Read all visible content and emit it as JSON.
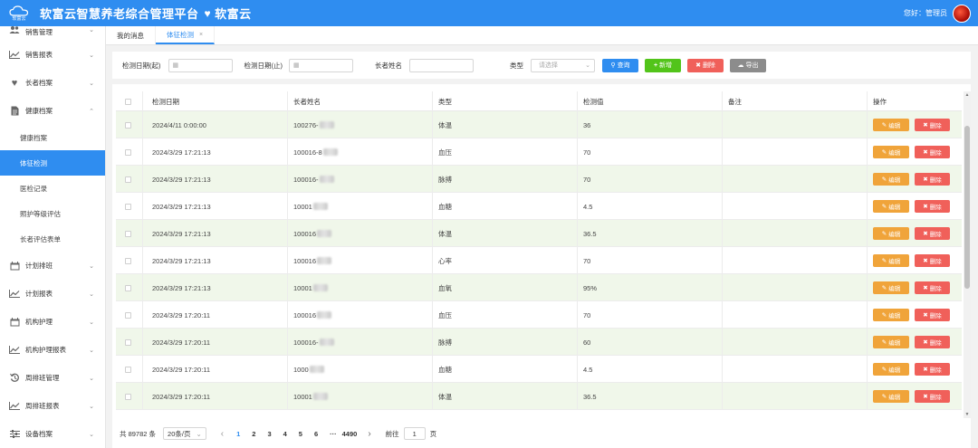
{
  "header": {
    "logo_text": "软富云",
    "title": "软富云智慧养老综合管理平台",
    "brand": "软富云",
    "greeting": "您好：管理员"
  },
  "sidebar": {
    "top_item": "销售管理",
    "items": [
      {
        "label": "销售报表",
        "icon": "chart-icon"
      },
      {
        "label": "长者档案",
        "icon": "heart-icon"
      },
      {
        "label": "健康档案",
        "icon": "document-icon"
      }
    ],
    "sub_items": [
      {
        "label": "健康档案",
        "active": false
      },
      {
        "label": "体征检测",
        "active": true
      },
      {
        "label": "医检记录",
        "active": false
      },
      {
        "label": "照护等级评估",
        "active": false
      },
      {
        "label": "长者评估表单",
        "active": false
      }
    ],
    "items_after": [
      {
        "label": "计划排班",
        "icon": "calendar-icon"
      },
      {
        "label": "计划报表",
        "icon": "chart-icon"
      },
      {
        "label": "机构护理",
        "icon": "calendar-icon"
      },
      {
        "label": "机构护理报表",
        "icon": "chart-icon"
      },
      {
        "label": "周排班管理",
        "icon": "history-icon"
      },
      {
        "label": "周排班报表",
        "icon": "chart-icon"
      },
      {
        "label": "设备档案",
        "icon": "sliders-icon"
      }
    ]
  },
  "tabs": [
    {
      "label": "我的消息"
    },
    {
      "label": "体征检测",
      "close": "×"
    }
  ],
  "filter": {
    "date_from_label": "检测日期(起)",
    "date_to_label": "检测日期(止)",
    "name_label": "长者姓名",
    "type_label": "类型",
    "type_placeholder": "请选择",
    "query": "查询",
    "add": "新增",
    "delete": "删除",
    "export": "导出"
  },
  "table": {
    "headers": [
      "检测日期",
      "长者姓名",
      "类型",
      "检测值",
      "备注",
      "操作"
    ],
    "edit_label": "编辑",
    "delete_label": "删除",
    "rows": [
      {
        "date": "2024/4/11 0:00:00",
        "name": "100276-",
        "type": "体温",
        "value": "36",
        "note": ""
      },
      {
        "date": "2024/3/29 17:21:13",
        "name": "100016-8",
        "type": "血压",
        "value": "70",
        "note": ""
      },
      {
        "date": "2024/3/29 17:21:13",
        "name": "100016-",
        "type": "脉搏",
        "value": "70",
        "note": ""
      },
      {
        "date": "2024/3/29 17:21:13",
        "name": "10001",
        "type": "血糖",
        "value": "4.5",
        "note": ""
      },
      {
        "date": "2024/3/29 17:21:13",
        "name": "100016",
        "type": "体温",
        "value": "36.5",
        "note": ""
      },
      {
        "date": "2024/3/29 17:21:13",
        "name": "100016",
        "type": "心率",
        "value": "70",
        "note": ""
      },
      {
        "date": "2024/3/29 17:21:13",
        "name": "10001",
        "type": "血氧",
        "value": "95%",
        "note": ""
      },
      {
        "date": "2024/3/29 17:20:11",
        "name": "100016",
        "type": "血压",
        "value": "70",
        "note": ""
      },
      {
        "date": "2024/3/29 17:20:11",
        "name": "100016-",
        "type": "脉搏",
        "value": "60",
        "note": ""
      },
      {
        "date": "2024/3/29 17:20:11",
        "name": "1000",
        "type": "血糖",
        "value": "4.5",
        "note": ""
      },
      {
        "date": "2024/3/29 17:20:11",
        "name": "10001",
        "type": "体温",
        "value": "36.5",
        "note": ""
      }
    ]
  },
  "pager": {
    "total": "共 89782 条",
    "page_size": "20条/页",
    "prev": "‹",
    "pages": [
      "1",
      "2",
      "3",
      "4",
      "5",
      "6"
    ],
    "ellipsis": "···",
    "last": "4490",
    "next": "›",
    "goto_label": "前往",
    "goto_value": "1",
    "goto_suffix": "页"
  },
  "colors": {
    "primary": "#2f8df0",
    "success": "#52c41a",
    "danger": "#f0605a",
    "warning": "#f0a43a",
    "gray": "#8c8c8c",
    "row_alt": "#f0f7ea"
  }
}
